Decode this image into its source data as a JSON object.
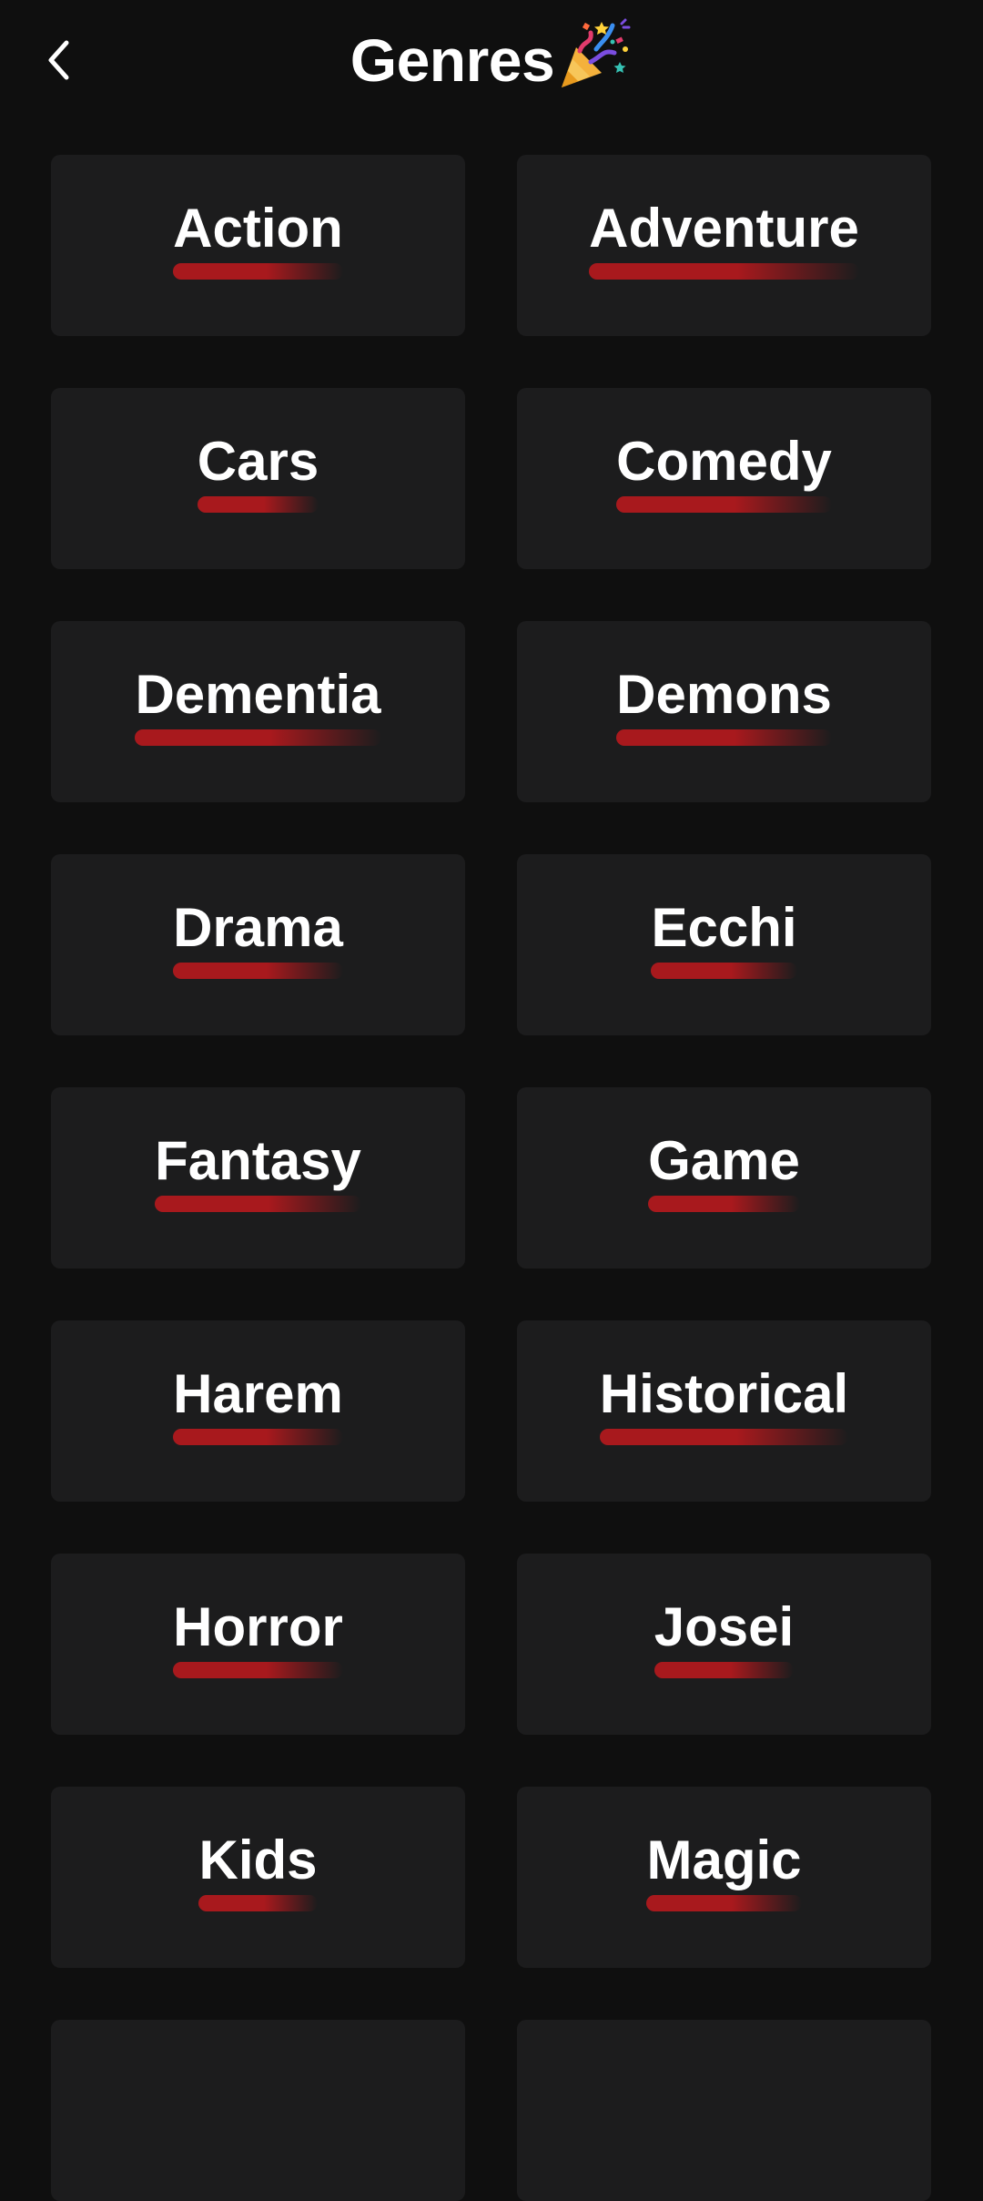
{
  "header": {
    "title": "Genres",
    "back_icon": "chevron-left-icon",
    "title_icon": "party-popper-icon"
  },
  "colors": {
    "background": "#0f0f0f",
    "card": "#1c1c1d",
    "accent": "#a8191d",
    "text": "#ffffff"
  },
  "genres": [
    {
      "label": "Action"
    },
    {
      "label": "Adventure"
    },
    {
      "label": "Cars"
    },
    {
      "label": "Comedy"
    },
    {
      "label": "Dementia"
    },
    {
      "label": "Demons"
    },
    {
      "label": "Drama"
    },
    {
      "label": "Ecchi"
    },
    {
      "label": "Fantasy"
    },
    {
      "label": "Game"
    },
    {
      "label": "Harem"
    },
    {
      "label": "Historical"
    },
    {
      "label": "Horror"
    },
    {
      "label": "Josei"
    },
    {
      "label": "Kids"
    },
    {
      "label": "Magic"
    },
    {
      "label": ""
    },
    {
      "label": ""
    }
  ]
}
